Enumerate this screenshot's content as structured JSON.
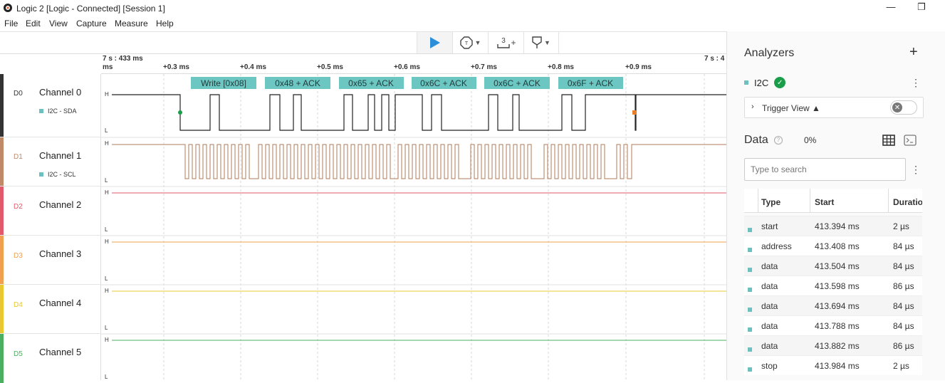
{
  "window": {
    "title": "Logic 2 [Logic - Connected] [Session 1]",
    "min_label": "—",
    "max_label": "❐"
  },
  "menu": [
    "File",
    "Edit",
    "View",
    "Capture",
    "Measure",
    "Help"
  ],
  "toolbar": {
    "play_icon": "play-icon",
    "trigger_icon": "trigger-icon",
    "measure_icon": "measure-icon",
    "measure_num": "3",
    "marker_icon": "marker-icon"
  },
  "timeaxis": {
    "start_label": "7 s : 433 ms",
    "start_unit": "ms",
    "ticks": [
      "+0.3 ms",
      "+0.4 ms",
      "+0.5 ms",
      "+0.6 ms",
      "+0.7 ms",
      "+0.8 ms",
      "+0.9 ms"
    ],
    "end_label": "7 s : 4"
  },
  "channels": [
    {
      "id": "D0",
      "name": "Channel 0",
      "analyzer": "I2C - SDA",
      "color": "#333333"
    },
    {
      "id": "D1",
      "name": "Channel 1",
      "analyzer": "I2C - SCL",
      "color": "#c08a68"
    },
    {
      "id": "D2",
      "name": "Channel 2",
      "analyzer": "",
      "color": "#e05a6b"
    },
    {
      "id": "D3",
      "name": "Channel 3",
      "analyzer": "",
      "color": "#f0a050"
    },
    {
      "id": "D4",
      "name": "Channel 4",
      "analyzer": "",
      "color": "#e8c830"
    },
    {
      "id": "D5",
      "name": "Channel 5",
      "analyzer": "",
      "color": "#4ab060"
    }
  ],
  "level_labels": {
    "high": "H",
    "low": "L"
  },
  "decoded": [
    "Write [0x08]",
    "0x48 + ACK",
    "0x65 + ACK",
    "0x6C + ACK",
    "0x6C + ACK",
    "0x6F + ACK"
  ],
  "panel": {
    "analyzers_title": "Analyzers",
    "analyzer_name": "I2C",
    "trigger_view": "Trigger View",
    "data_title": "Data",
    "progress": "0%",
    "search_placeholder": "Type to search",
    "columns": [
      "Type",
      "Start",
      "Duration"
    ],
    "rows": [
      {
        "type": "start",
        "start": "413.394 ms",
        "duration": "2 µs"
      },
      {
        "type": "address",
        "start": "413.408 ms",
        "duration": "84 µs"
      },
      {
        "type": "data",
        "start": "413.504 ms",
        "duration": "84 µs"
      },
      {
        "type": "data",
        "start": "413.598 ms",
        "duration": "86 µs"
      },
      {
        "type": "data",
        "start": "413.694 ms",
        "duration": "84 µs"
      },
      {
        "type": "data",
        "start": "413.788 ms",
        "duration": "84 µs"
      },
      {
        "type": "data",
        "start": "413.882 ms",
        "duration": "86 µs"
      },
      {
        "type": "stop",
        "start": "413.984 ms",
        "duration": "2 µs"
      }
    ]
  }
}
